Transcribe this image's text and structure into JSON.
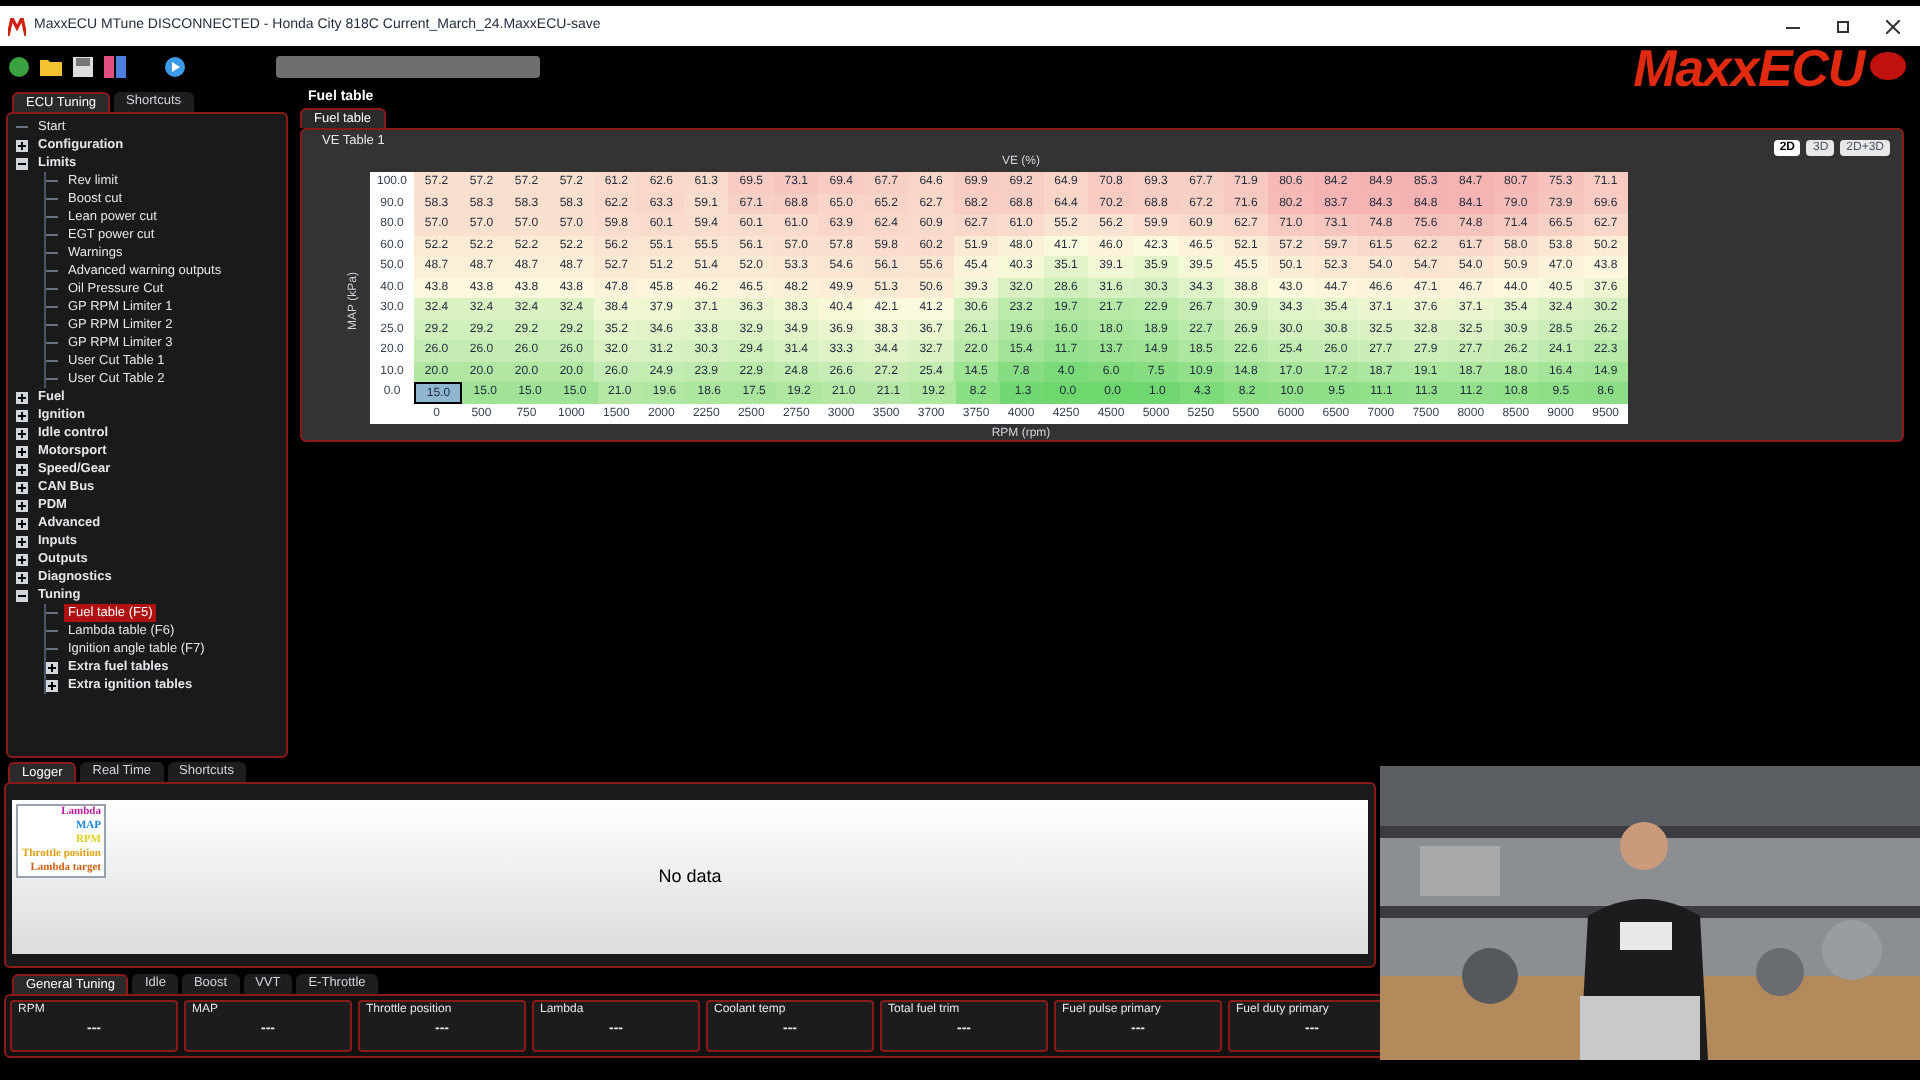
{
  "window": {
    "title": "MaxxECU MTune DISCONNECTED - Honda City 818C Current_March_24.MaxxECU-save"
  },
  "logo": {
    "text": "MaxxECU"
  },
  "page_title": "Fuel table",
  "left_tabs": [
    {
      "label": "ECU Tuning",
      "selected": true
    },
    {
      "label": "Shortcuts",
      "selected": false
    }
  ],
  "tree": [
    {
      "label": "Start",
      "selected": false
    },
    {
      "label": "Configuration",
      "expanded": false,
      "selected": false
    },
    {
      "label": "Limits",
      "expanded": true,
      "selected": false,
      "children": [
        {
          "label": "Rev limit",
          "selected": false
        },
        {
          "label": "Boost cut",
          "selected": false
        },
        {
          "label": "Lean power cut",
          "selected": false
        },
        {
          "label": "EGT power cut",
          "selected": false
        },
        {
          "label": "Warnings",
          "selected": false
        },
        {
          "label": "Advanced warning outputs",
          "selected": false
        },
        {
          "label": "Oil Pressure Cut",
          "selected": false
        },
        {
          "label": "GP RPM Limiter 1",
          "selected": false
        },
        {
          "label": "GP RPM Limiter 2",
          "selected": false
        },
        {
          "label": "GP RPM Limiter 3",
          "selected": false
        },
        {
          "label": "User Cut Table 1",
          "selected": false
        },
        {
          "label": "User Cut Table 2",
          "selected": false
        }
      ]
    },
    {
      "label": "Fuel",
      "expanded": false,
      "selected": false
    },
    {
      "label": "Ignition",
      "expanded": false,
      "selected": false
    },
    {
      "label": "Idle control",
      "expanded": false,
      "selected": false
    },
    {
      "label": "Motorsport",
      "expanded": false,
      "selected": false
    },
    {
      "label": "Speed/Gear",
      "expanded": false,
      "selected": false
    },
    {
      "label": "CAN Bus",
      "expanded": false,
      "selected": false
    },
    {
      "label": "PDM",
      "expanded": false,
      "selected": false
    },
    {
      "label": "Advanced",
      "expanded": false,
      "selected": false
    },
    {
      "label": "Inputs",
      "expanded": false,
      "selected": false
    },
    {
      "label": "Outputs",
      "expanded": false,
      "selected": false
    },
    {
      "label": "Diagnostics",
      "expanded": false,
      "selected": false
    },
    {
      "label": "Tuning",
      "expanded": true,
      "selected": false,
      "children": [
        {
          "label": "Fuel table (F5)",
          "selected": true
        },
        {
          "label": "Lambda table (F6)",
          "selected": false
        },
        {
          "label": "Ignition angle table (F7)",
          "selected": false
        },
        {
          "label": "Extra fuel tables",
          "expanded": false,
          "selected": false
        },
        {
          "label": "Extra ignition tables",
          "expanded": false,
          "selected": false
        }
      ]
    }
  ],
  "main_tabs": [
    {
      "label": "Fuel table",
      "selected": true
    }
  ],
  "table_group": {
    "title": "VE Table 1",
    "view_buttons": [
      {
        "label": "2D",
        "selected": true
      },
      {
        "label": "3D",
        "selected": false
      },
      {
        "label": "2D+3D",
        "selected": false
      }
    ],
    "value_label": "VE (%)",
    "y_label": "MAP (kPa)",
    "x_label": "RPM (rpm)",
    "rpm": [
      "0",
      "500",
      "750",
      "1000",
      "1500",
      "2000",
      "2250",
      "2500",
      "2750",
      "3000",
      "3500",
      "3700",
      "3750",
      "4000",
      "4250",
      "4500",
      "5000",
      "5250",
      "5500",
      "6000",
      "6500",
      "7000",
      "7500",
      "8000",
      "8500",
      "9000",
      "9500"
    ],
    "rows": [
      {
        "map": "100.0",
        "values": [
          "57.2",
          "57.2",
          "57.2",
          "57.2",
          "61.2",
          "62.6",
          "61.3",
          "69.5",
          "73.1",
          "69.4",
          "67.7",
          "64.6",
          "69.9",
          "69.2",
          "64.9",
          "70.8",
          "69.3",
          "67.7",
          "71.9",
          "80.6",
          "84.2",
          "84.9",
          "85.3",
          "84.7",
          "80.7",
          "75.3",
          "71.1"
        ]
      },
      {
        "map": "90.0",
        "values": [
          "58.3",
          "58.3",
          "58.3",
          "58.3",
          "62.2",
          "63.3",
          "59.1",
          "67.1",
          "68.8",
          "65.0",
          "65.2",
          "62.7",
          "68.2",
          "68.8",
          "64.4",
          "70.2",
          "68.8",
          "67.2",
          "71.6",
          "80.2",
          "83.7",
          "84.3",
          "84.8",
          "84.1",
          "79.0",
          "73.9",
          "69.6"
        ]
      },
      {
        "map": "80.0",
        "values": [
          "57.0",
          "57.0",
          "57.0",
          "57.0",
          "59.8",
          "60.1",
          "59.4",
          "60.1",
          "61.0",
          "63.9",
          "62.4",
          "60.9",
          "62.7",
          "61.0",
          "55.2",
          "56.2",
          "59.9",
          "60.9",
          "62.7",
          "71.0",
          "73.1",
          "74.8",
          "75.6",
          "74.8",
          "71.4",
          "66.5",
          "62.7"
        ]
      },
      {
        "map": "60.0",
        "values": [
          "52.2",
          "52.2",
          "52.2",
          "52.2",
          "56.2",
          "55.1",
          "55.5",
          "56.1",
          "57.0",
          "57.8",
          "59.8",
          "60.2",
          "51.9",
          "48.0",
          "41.7",
          "46.0",
          "42.3",
          "46.5",
          "52.1",
          "57.2",
          "59.7",
          "61.5",
          "62.2",
          "61.7",
          "58.0",
          "53.8",
          "50.2"
        ]
      },
      {
        "map": "50.0",
        "values": [
          "48.7",
          "48.7",
          "48.7",
          "48.7",
          "52.7",
          "51.2",
          "51.4",
          "52.0",
          "53.3",
          "54.6",
          "56.1",
          "55.6",
          "45.4",
          "40.3",
          "35.1",
          "39.1",
          "35.9",
          "39.5",
          "45.5",
          "50.1",
          "52.3",
          "54.0",
          "54.7",
          "54.0",
          "50.9",
          "47.0",
          "43.8"
        ]
      },
      {
        "map": "40.0",
        "values": [
          "43.8",
          "43.8",
          "43.8",
          "43.8",
          "47.8",
          "45.8",
          "46.2",
          "46.5",
          "48.2",
          "49.9",
          "51.3",
          "50.6",
          "39.3",
          "32.0",
          "28.6",
          "31.6",
          "30.3",
          "34.3",
          "38.8",
          "43.0",
          "44.7",
          "46.6",
          "47.1",
          "46.7",
          "44.0",
          "40.5",
          "37.6"
        ]
      },
      {
        "map": "30.0",
        "values": [
          "32.4",
          "32.4",
          "32.4",
          "32.4",
          "38.4",
          "37.9",
          "37.1",
          "36.3",
          "38.3",
          "40.4",
          "42.1",
          "41.2",
          "30.6",
          "23.2",
          "19.7",
          "21.7",
          "22.9",
          "26.7",
          "30.9",
          "34.3",
          "35.4",
          "37.1",
          "37.6",
          "37.1",
          "35.4",
          "32.4",
          "30.2"
        ]
      },
      {
        "map": "25.0",
        "values": [
          "29.2",
          "29.2",
          "29.2",
          "29.2",
          "35.2",
          "34.6",
          "33.8",
          "32.9",
          "34.9",
          "36.9",
          "38.3",
          "36.7",
          "26.1",
          "19.6",
          "16.0",
          "18.0",
          "18.9",
          "22.7",
          "26.9",
          "30.0",
          "30.8",
          "32.5",
          "32.8",
          "32.5",
          "30.9",
          "28.5",
          "26.2"
        ]
      },
      {
        "map": "20.0",
        "values": [
          "26.0",
          "26.0",
          "26.0",
          "26.0",
          "32.0",
          "31.2",
          "30.3",
          "29.4",
          "31.4",
          "33.3",
          "34.4",
          "32.7",
          "22.0",
          "15.4",
          "11.7",
          "13.7",
          "14.9",
          "18.5",
          "22.6",
          "25.4",
          "26.0",
          "27.7",
          "27.9",
          "27.7",
          "26.2",
          "24.1",
          "22.3"
        ]
      },
      {
        "map": "10.0",
        "values": [
          "20.0",
          "20.0",
          "20.0",
          "20.0",
          "26.0",
          "24.9",
          "23.9",
          "22.9",
          "24.8",
          "26.6",
          "27.2",
          "25.4",
          "14.5",
          "7.8",
          "4.0",
          "6.0",
          "7.5",
          "10.9",
          "14.8",
          "17.0",
          "17.2",
          "18.7",
          "19.1",
          "18.7",
          "18.0",
          "16.4",
          "14.9"
        ]
      },
      {
        "map": "0.0",
        "values": [
          {
            "value": "15.0",
            "selected": true
          },
          "15.0",
          "15.0",
          "15.0",
          "21.0",
          "19.6",
          "18.6",
          "17.5",
          "19.2",
          "21.0",
          "21.1",
          "19.2",
          "8.2",
          "1.3",
          "0.0",
          "0.0",
          "1.0",
          "4.3",
          "8.2",
          "10.0",
          "9.5",
          "11.1",
          "11.3",
          "11.2",
          "10.8",
          "9.5",
          "8.6"
        ]
      }
    ]
  },
  "logger_tabs": [
    {
      "label": "Logger",
      "selected": true
    },
    {
      "label": "Real Time",
      "selected": false
    },
    {
      "label": "Shortcuts",
      "selected": false
    }
  ],
  "logger": {
    "legend": [
      {
        "label": "Lambda",
        "color": "#c0189c"
      },
      {
        "label": "MAP",
        "color": "#1e88e5"
      },
      {
        "label": "RPM",
        "color": "#e0d020"
      },
      {
        "label": "Throttle position",
        "color": "#e0a010"
      },
      {
        "label": "Lambda target",
        "color": "#d06010"
      }
    ],
    "message": "No data"
  },
  "gauge_tabs": [
    {
      "label": "General Tuning",
      "selected": true
    },
    {
      "label": "Idle",
      "selected": false
    },
    {
      "label": "Boost",
      "selected": false
    },
    {
      "label": "VVT",
      "selected": false
    },
    {
      "label": "E-Throttle",
      "selected": false
    }
  ],
  "gauges": [
    {
      "label": "RPM",
      "value": "---"
    },
    {
      "label": "MAP",
      "value": "---"
    },
    {
      "label": "Throttle position",
      "value": "---"
    },
    {
      "label": "Lambda",
      "value": "---"
    },
    {
      "label": "Coolant temp",
      "value": "---"
    },
    {
      "label": "Total fuel trim",
      "value": "---"
    },
    {
      "label": "Fuel pulse primary",
      "value": "---"
    },
    {
      "label": "Fuel duty primary",
      "value": "---"
    }
  ]
}
